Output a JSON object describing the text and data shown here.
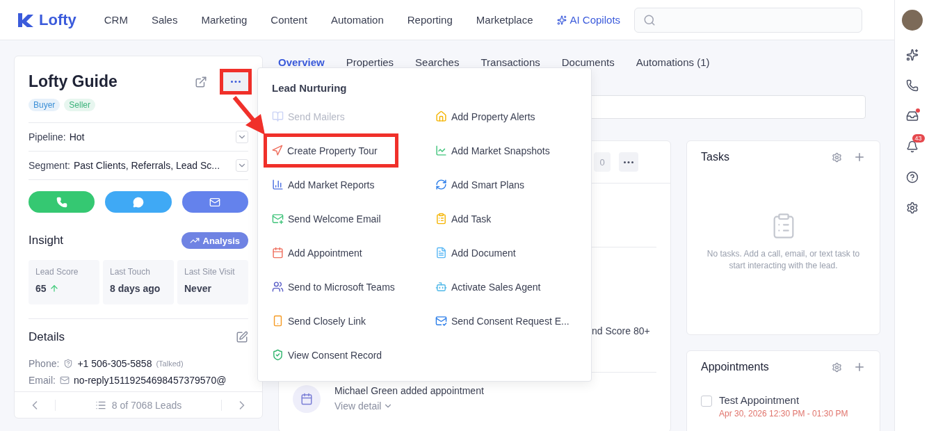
{
  "nav": {
    "logo": "Lofty",
    "items": [
      "CRM",
      "Sales",
      "Marketing",
      "Content",
      "Automation",
      "Reporting",
      "Marketplace"
    ],
    "ai_item": "AI Copilots"
  },
  "rail": {
    "notification_count": "43",
    "inbox_unread": true
  },
  "lead": {
    "name": "Lofty Guide",
    "tags": [
      {
        "label": "Buyer",
        "color": "#3b8fd6"
      },
      {
        "label": "Seller",
        "color": "#3bb27a"
      }
    ],
    "more_button": {
      "annotated": true
    },
    "fields": [
      {
        "label": "Pipeline:",
        "value": "Hot"
      },
      {
        "label": "Segment:",
        "value": "Past Clients, Referrals, Lead Sc..."
      }
    ],
    "insight": {
      "title": "Insight",
      "button": "Analysis",
      "stats": [
        {
          "label": "Lead Score",
          "value": "65",
          "rising": true
        },
        {
          "label": "Last Touch",
          "value": "8 days ago"
        },
        {
          "label": "Last Site Visit",
          "value": "Never"
        }
      ]
    },
    "details": {
      "title": "Details",
      "phone_label": "Phone:",
      "phone": "+1 506-305-5858",
      "phone_note": "(Talked)",
      "email_label": "Email:",
      "email": "no-reply15119254698457379570@"
    },
    "pager": "8 of 7068 Leads"
  },
  "tabs": [
    {
      "label": "Overview",
      "selected": true
    },
    {
      "label": "Properties",
      "selected": false
    },
    {
      "label": "Searches",
      "selected": false
    },
    {
      "label": "Transactions",
      "selected": false
    },
    {
      "label": "Documents",
      "selected": false
    },
    {
      "label": "Automations (1)",
      "selected": false
    }
  ],
  "timeline": {
    "like_count": "0",
    "partial_text": "nd Score 80+",
    "entry": {
      "title": "Michael Green added appointment",
      "link": "View detail"
    }
  },
  "menu": {
    "title": "Lead Nurturing",
    "items": [
      {
        "label": "Send Mailers",
        "kind": "mailbox",
        "disabled": true,
        "annotated": false
      },
      {
        "label": "Add Property Alerts",
        "kind": "house",
        "disabled": false,
        "annotated": false
      },
      {
        "label": "Create Property Tour",
        "kind": "tour",
        "disabled": false,
        "annotated": true
      },
      {
        "label": "Add Market Snapshots",
        "kind": "snapshot",
        "disabled": false,
        "annotated": false
      },
      {
        "label": "Add Market Reports",
        "kind": "bars",
        "disabled": false,
        "annotated": false
      },
      {
        "label": "Add Smart Plans",
        "kind": "plans",
        "disabled": false,
        "annotated": false
      },
      {
        "label": "Send Welcome Email",
        "kind": "mail",
        "disabled": false,
        "annotated": false
      },
      {
        "label": "Add Task",
        "kind": "task",
        "disabled": false,
        "annotated": false
      },
      {
        "label": "Add Appointment",
        "kind": "calendar",
        "disabled": false,
        "annotated": false
      },
      {
        "label": "Add Document",
        "kind": "document",
        "disabled": false,
        "annotated": false
      },
      {
        "label": "Send to Microsoft Teams",
        "kind": "teams",
        "disabled": false,
        "annotated": false
      },
      {
        "label": "Activate Sales Agent",
        "kind": "bot",
        "disabled": false,
        "annotated": false
      },
      {
        "label": "Send Closely Link",
        "kind": "phone",
        "disabled": false,
        "annotated": false
      },
      {
        "label": "Send Consent Request E...",
        "kind": "consent",
        "disabled": false,
        "annotated": false
      },
      {
        "label": "View Consent Record",
        "kind": "shield",
        "disabled": false,
        "annotated": false
      }
    ]
  },
  "tasks": {
    "title": "Tasks",
    "empty": "No tasks. Add a call, email, or text task to start interacting with the lead."
  },
  "appointments": {
    "title": "Appointments",
    "items": [
      {
        "title": "Test Appointment",
        "time": "Apr 30, 2026 12:30 PM - 01:30 PM",
        "checked": false
      }
    ]
  }
}
